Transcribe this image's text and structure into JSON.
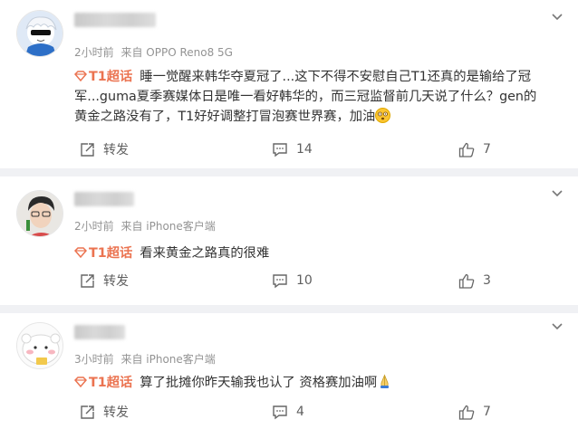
{
  "comments": [
    {
      "time": "2小时前",
      "source": "来自 OPPO Reno8 5G",
      "topic": "T1超话",
      "lines": [
        "睡一觉醒来韩华夺夏冠了...这下不得不安慰自己T1还真的是输给了冠",
        "军...guma夏季赛媒体日是唯一看好韩华的，而三冠监督前几天说了什么？gen的",
        "黄金之路没有了，T1好好调整打冒泡赛世界赛，加油"
      ],
      "emoji": "dazed-face",
      "repost_label": "转发",
      "comment_count": "14",
      "like_count": "7"
    },
    {
      "time": "2小时前",
      "source": "来自 iPhone客户端",
      "topic": "T1超话",
      "lines": [
        "看来黄金之路真的很难"
      ],
      "repost_label": "转发",
      "comment_count": "10",
      "like_count": "3"
    },
    {
      "time": "3小时前",
      "source": "来自 iPhone客户端",
      "topic": "T1超话",
      "lines": [
        "算了批摊你昨天输我也认了 资格赛加油啊"
      ],
      "emoji": "praying-emoji",
      "repost_label": "转发",
      "comment_count": "4",
      "like_count": "7"
    }
  ],
  "colors": {
    "topic": "#eb7350",
    "meta": "#939393",
    "background": "#f0f1f4"
  }
}
